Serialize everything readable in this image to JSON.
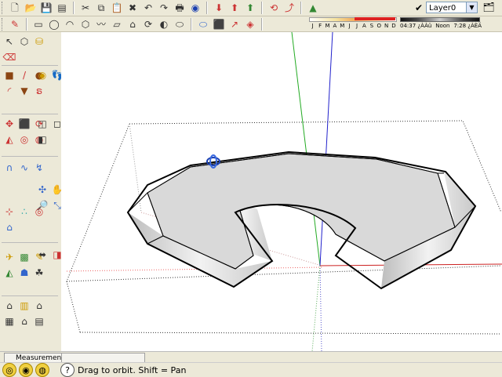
{
  "toolbar": {
    "row1_icons": [
      "new-file-icon",
      "open-folder-icon",
      "save-icon",
      "new-scene-icon",
      "cut-icon",
      "copy-icon",
      "paste-icon",
      "erase-selected-icon",
      "undo-icon",
      "redo-icon",
      "print-icon",
      "model-info-icon",
      "get-models-icon",
      "share-model-icon",
      "share-component-icon",
      "get-photo-texture-icon",
      "preview-google-earth-icon"
    ],
    "row2_icons": [
      "pencil-icon",
      "rectangle-icon",
      "circle-icon",
      "arc-icon",
      "polygon-icon",
      "freehand-icon",
      "move-icon",
      "pushpull-icon",
      "rotate-icon",
      "followme-icon",
      "scale-icon",
      "offset-icon",
      "paint-icon",
      "tape-measure-icon"
    ]
  },
  "shadows": {
    "months": [
      "J",
      "F",
      "M",
      "A",
      "M",
      "J",
      "J",
      "A",
      "S",
      "O",
      "N",
      "D"
    ],
    "time_start": "04:37 ¿ÀÀü",
    "time_noon": "Noon",
    "time_end": "7:28 ¿ÀÈÄ"
  },
  "layers": {
    "current": "Layer0",
    "dropdown_glyph": "▼",
    "check_glyph": "✔"
  },
  "measurements": {
    "label": "Measurements",
    "value": ""
  },
  "status": {
    "message": "Drag to orbit.  Shift = Pan",
    "help_glyph": "?"
  }
}
